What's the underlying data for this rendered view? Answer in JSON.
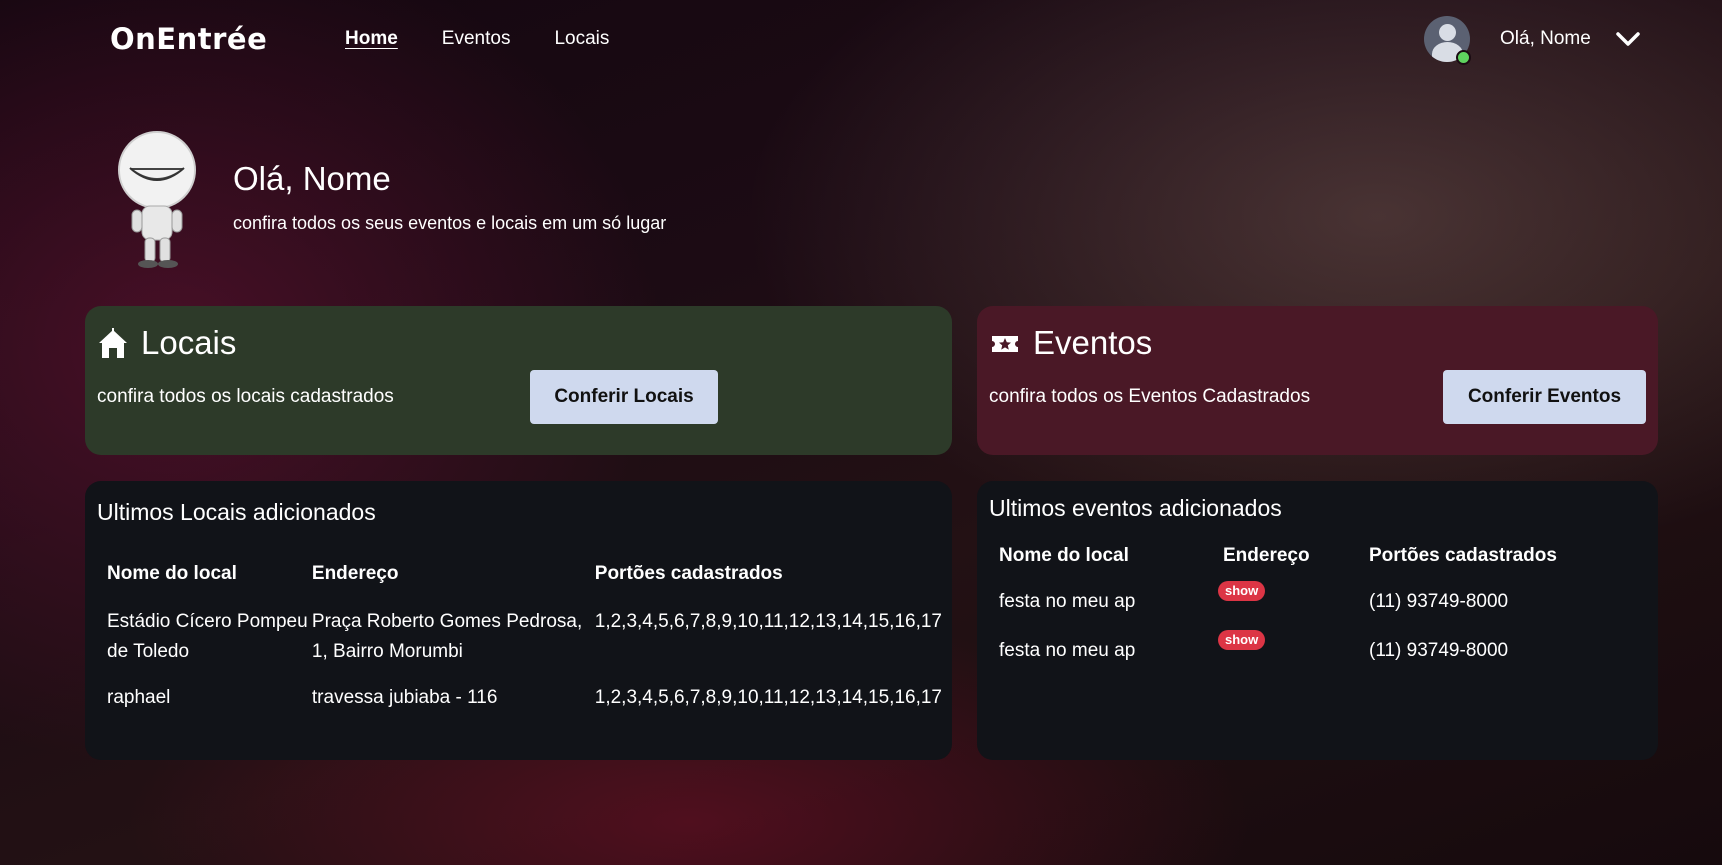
{
  "header": {
    "logo": "OnEntrée",
    "nav": [
      {
        "label": "Home",
        "active": true
      },
      {
        "label": "Eventos",
        "active": false
      },
      {
        "label": "Locais",
        "active": false
      }
    ],
    "user_greeting": "Olá, Nome"
  },
  "hero": {
    "title": "Olá, Nome",
    "subtitle": "confira todos os seus eventos e locais em um só lugar"
  },
  "locais_card": {
    "title": "Locais",
    "description": "confira todos os locais cadastrados",
    "button": "Conferir Locais",
    "color": "#2d3a29"
  },
  "eventos_card": {
    "title": "Eventos",
    "description": "confira todos os Eventos Cadastrados",
    "button": "Conferir Eventos",
    "color": "#4a1826"
  },
  "locais_table": {
    "title": "Ultimos Locais adicionados",
    "columns": [
      "Nome do local",
      "Endereço",
      "Portões cadastrados"
    ],
    "rows": [
      [
        "Estádio Cícero Pompeu de Toledo",
        "Praça Roberto Gomes Pedrosa, 1, Bairro Morumbi",
        "1,2,3,4,5,6,7,8,9,10,11,12,13,14,15,16,17"
      ],
      [
        "raphael",
        "travessa jubiaba - 116",
        "1,2,3,4,5,6,7,8,9,10,11,12,13,14,15,16,17"
      ]
    ]
  },
  "eventos_table": {
    "title": "Ultimos eventos adicionados",
    "columns": [
      "Nome do local",
      "Endereço",
      "Portões cadastrados"
    ],
    "rows": [
      [
        "festa no meu ap",
        "show",
        "(11) 93749-8000"
      ],
      [
        "festa no meu ap",
        "show",
        "(11) 93749-8000"
      ]
    ]
  },
  "colors": {
    "badge": "#dc3545",
    "button": "#cfd9ee",
    "panel": "#111318",
    "online_indicator": "#5fd35f"
  }
}
